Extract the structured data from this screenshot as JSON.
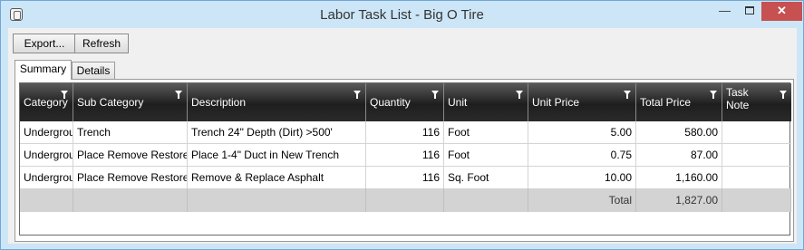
{
  "window": {
    "title": "Labor Task List - Big O Tire",
    "min_label": "—",
    "close_label": "✕"
  },
  "toolbar": {
    "export_label": "Export...",
    "refresh_label": "Refresh"
  },
  "tabs": [
    {
      "label": "Summary",
      "selected": true
    },
    {
      "label": "Details",
      "selected": false
    }
  ],
  "grid": {
    "columns": [
      "Category",
      "Sub Category",
      "Description",
      "Quantity",
      "Unit",
      "Unit Price",
      "Total Price",
      "Task Note"
    ],
    "rows": [
      [
        "Underground",
        "Trench",
        "Trench 24\" Depth  (Dirt)    >500'",
        "116",
        "Foot",
        "5.00",
        "580.00",
        ""
      ],
      [
        "Underground",
        "Place Remove Restore",
        "Place 1-4\" Duct in New Trench",
        "116",
        "Foot",
        "0.75",
        "87.00",
        ""
      ],
      [
        "Underground",
        "Place Remove Restore",
        "Remove & Replace Asphalt",
        "116",
        "Sq. Foot",
        "10.00",
        "1,160.00",
        ""
      ]
    ],
    "footer": {
      "label": "Total",
      "value": "1,827.00"
    }
  },
  "colors": {
    "title_bar": "#cde6f7",
    "header_bg": "#2a2a2a",
    "close_button": "#c75050",
    "footer_bg": "#d3d3d3"
  }
}
